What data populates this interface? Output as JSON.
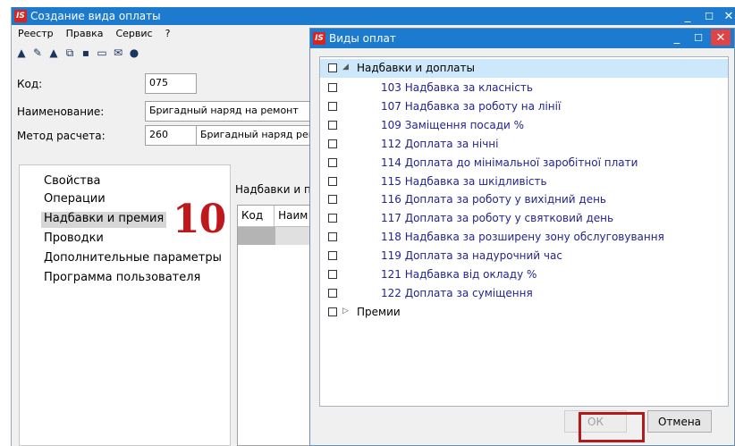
{
  "main_window": {
    "title": "Создание вида оплаты",
    "menu": [
      "Реестр",
      "Правка",
      "Сервис",
      "?"
    ],
    "fields": {
      "code_label": "Код:",
      "code_value": "075",
      "name_label": "Наименование:",
      "name_value": "Бригадный наряд на ремонт",
      "method_label": "Метод расчета:",
      "method_code": "260",
      "method_name": "Бригадный наряд рем"
    },
    "sections": [
      "Свойства",
      "Операции",
      "Надбавки и премия",
      "Проводки",
      "Дополнительные параметры",
      "Программа пользователя"
    ],
    "selected_section_index": 2,
    "right_panel_label": "Надбавки и п",
    "grid_headers": [
      "Код",
      "Наим"
    ],
    "annotation_number": "10"
  },
  "dialog": {
    "title": "Виды оплат",
    "tree": {
      "root_label": "Надбавки и доплаты",
      "children": [
        "103 Надбавка за класність",
        "107 Надбавка за роботу на лінії",
        "109 Заміщення посади %",
        "112 Доплата за нічні",
        "114 Доплата до мінімальної заробітної плати",
        "115 Надбавка за шкідливість",
        "116 Доплата за роботу у вихідний день",
        "117 Доплата за роботу у святковий день",
        "118 Надбавка за розширену зону обслуговування",
        "119 Доплата за надурочний час",
        "121 Надбавка від окладу %",
        "122 Доплата за суміщення"
      ],
      "second_root_label": "Премии"
    },
    "ok_label": "ОК",
    "cancel_label": "Отмена"
  },
  "colors": {
    "titlebar": "#1d7bcf",
    "close": "#e04343",
    "accent_red": "#c0171d",
    "tree_text": "#23248e"
  },
  "app_logo_text": "IS"
}
